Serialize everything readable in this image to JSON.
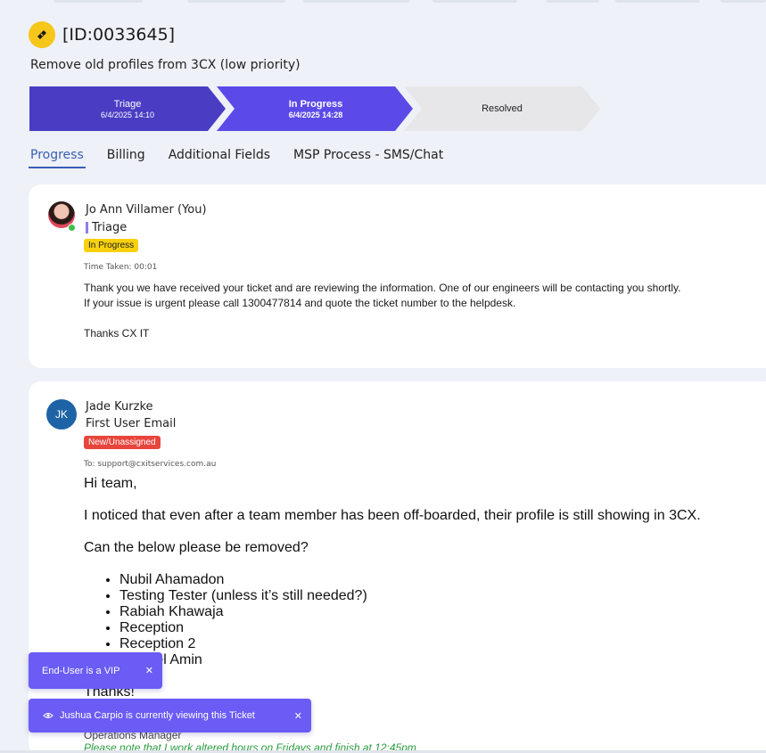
{
  "ticket": {
    "id": "[ID:0033645]",
    "subject": "Remove old profiles from 3CX (low priority)"
  },
  "stages": [
    {
      "name": "Triage",
      "time": "6/4/2025 14:10"
    },
    {
      "name": "In Progress",
      "time": "6/4/2025 14:28"
    },
    {
      "name": "Resolved",
      "time": ""
    }
  ],
  "tabs": [
    "Progress",
    "Billing",
    "Additional Fields",
    "MSP Process - SMS/Chat"
  ],
  "entries": [
    {
      "author": "Jo Ann Villamer (You)",
      "subline": "Triage",
      "status": "In Progress",
      "meta": "Time Taken: 00:01",
      "edge": "6",
      "body": [
        "Thank you we have received your ticket and are reviewing the information. One of our engineers will be contacting you shortly.",
        "If your issue is urgent please call 1300477814 and quote the ticket number to the helpdesk.",
        "Thanks CX IT"
      ]
    },
    {
      "author": "Jade Kurzke",
      "initials": "JK",
      "subline": "First User Email",
      "status": "New/Unassigned",
      "meta": "To: support@cxitservices.com.au",
      "edge": "6",
      "email": {
        "greeting": "Hi team,",
        "p1": "I noticed that even after a team member has been off-boarded, their profile is still showing in 3CX.",
        "p2": "Can the below please be removed?",
        "items": [
          "Nubil Ahamadon",
          "Testing Tester (unless it’s still needed?)",
          "Rabiah Khawaja",
          "Reception",
          "Reception 2",
          "Wakeel Amin"
        ],
        "closing": "Thanks!",
        "sig_title": "Operations Manager",
        "sig_note": "Please note that I work altered hours on Fridays and finish at 12:45pm"
      }
    }
  ],
  "toasts": [
    {
      "text": "End-User is a VIP",
      "close": "✕"
    },
    {
      "text": "Jushua Carpio is currently viewing this Ticket",
      "close": "✕",
      "icon": "eye-icon"
    }
  ],
  "colors": {
    "stage_done": "#4a3dc4",
    "stage_active": "#5b4ae8",
    "stage_pending": "#e7e7e9",
    "tab_active": "#3a5fb4",
    "badge_progress": "#f7d10d",
    "badge_new": "#e8453c",
    "toast": "#6b5cf5",
    "signature_note": "#2a9c3f"
  }
}
